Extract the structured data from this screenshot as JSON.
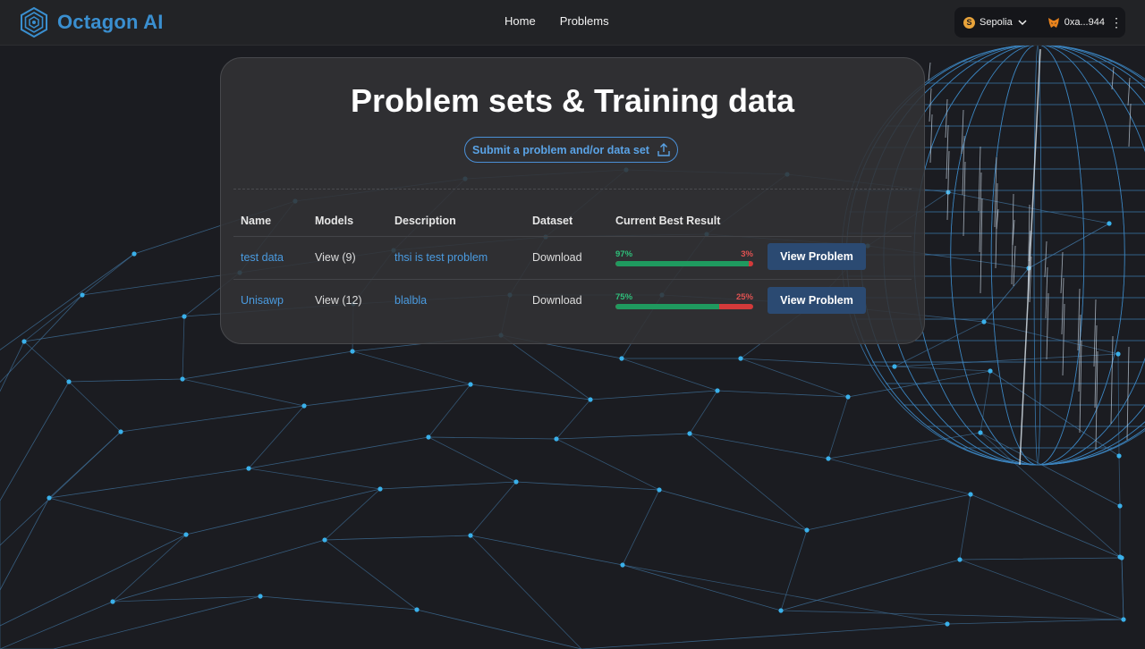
{
  "header": {
    "brand": "Octagon AI",
    "nav": [
      "Home",
      "Problems"
    ],
    "network": "Sepolia",
    "network_badge": "S",
    "account": "0xa...944"
  },
  "main": {
    "title": "Problem sets & Training data",
    "submit_label": "Submit a problem and/or data set",
    "columns": [
      "Name",
      "Models",
      "Description",
      "Dataset",
      "Current Best Result"
    ],
    "rows": [
      {
        "name": "test data",
        "models": "View (9)",
        "description": "thsi is test problem",
        "dataset": "Download",
        "good": "97%",
        "bad": "3%",
        "score": 0.97,
        "action": "View Problem"
      },
      {
        "name": "Unisawp",
        "models": "View (12)",
        "description": "blalbla",
        "dataset": "Download",
        "good": "75%",
        "bad": "25%",
        "score": 0.75,
        "action": "View Problem"
      }
    ]
  },
  "colors": {
    "accent": "#3a8fd0",
    "good": "#1f9a5f",
    "bad": "#d33a3a",
    "button": "#2b4a72"
  },
  "icons": [
    "octagon-logo-icon",
    "chevron-down-icon",
    "metamask-fox-icon",
    "kebab-menu-icon",
    "upload-icon"
  ]
}
